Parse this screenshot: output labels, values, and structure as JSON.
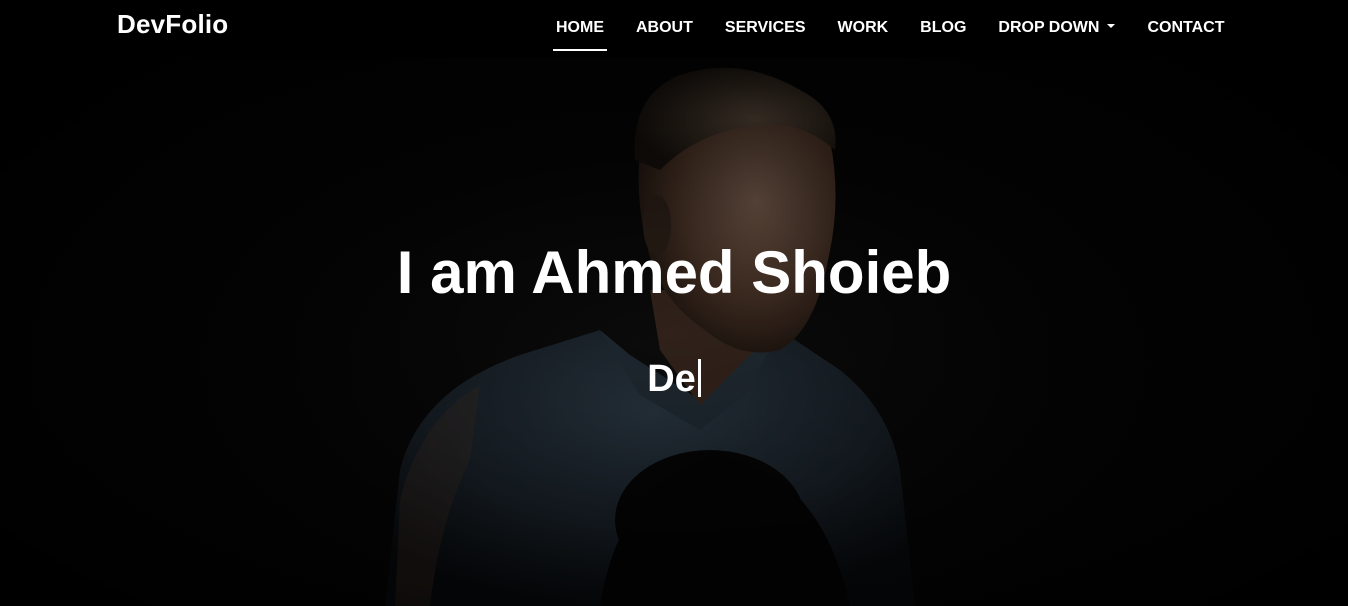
{
  "brand": {
    "name": "DevFolio"
  },
  "nav": {
    "items": [
      {
        "label": "HOME",
        "active": true
      },
      {
        "label": "ABOUT"
      },
      {
        "label": "SERVICES"
      },
      {
        "label": "WORK"
      },
      {
        "label": "BLOG"
      },
      {
        "label": "DROP DOWN",
        "has_caret": true
      },
      {
        "label": "CONTACT"
      }
    ]
  },
  "intro": {
    "title": "I am Ahmed Shoieb",
    "typed_text": "De"
  },
  "colors": {
    "navbar_bg": "#000000",
    "text": "#ffffff",
    "hero_bg": "#050505"
  }
}
